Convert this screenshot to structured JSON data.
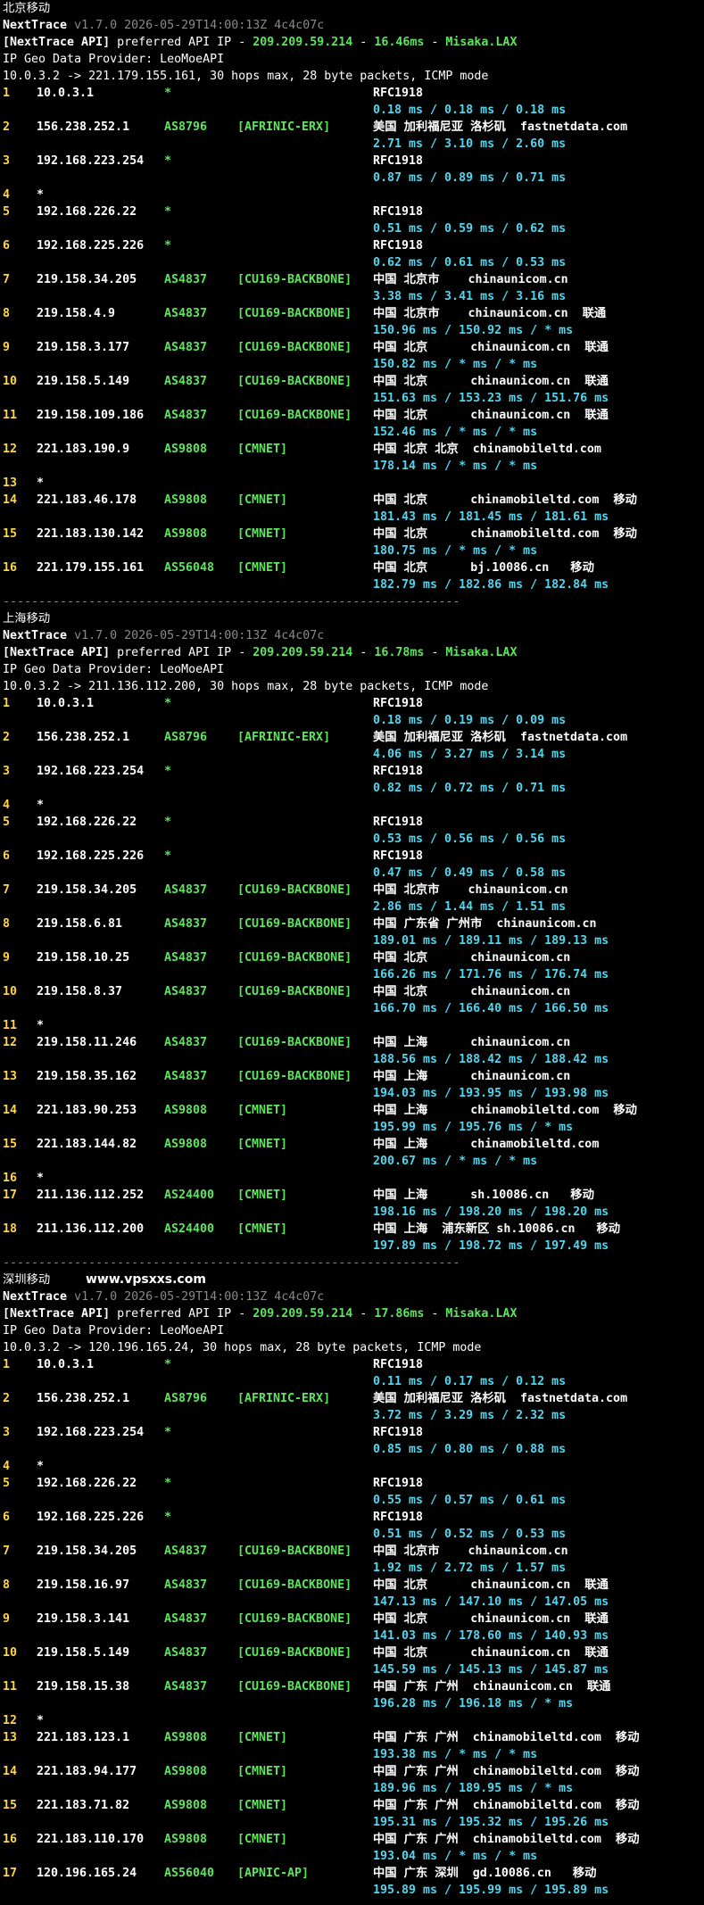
{
  "colors": {
    "background": "#000000",
    "text": "#ffffff",
    "hop_number": "#ffd54a",
    "asn": "#5ce65c",
    "rtt": "#4fd7f0",
    "muted": "#8a8a8a"
  },
  "watermark": "www.vpsxxs.com",
  "separator": "----------------------------------------------------------------",
  "sections": [
    {
      "title": "北京移动",
      "brand": "NextTrace",
      "version": "v1.7.0 2026-05-29T14:00:13Z 4c4c07c",
      "api_tag": "[NextTrace API]",
      "api_mid": " preferred API IP - ",
      "api_ip": "209.209.59.214",
      "api_dash": " - ",
      "api_ms": "16.46ms",
      "api_dash2": " - ",
      "api_node": "Misaka.LAX",
      "geo_provider": "IP Geo Data Provider: LeoMoeAPI",
      "trace_info": "10.0.3.2 -> 221.179.155.161, 30 hops max, 28 byte packets, ICMP mode",
      "hops": [
        {
          "num": "1",
          "ip": "10.0.3.1",
          "asn": "*",
          "tag": "",
          "geo": "RFC1918",
          "host": "",
          "rtt": "0.18 ms / 0.18 ms / 0.18 ms"
        },
        {
          "num": "2",
          "ip": "156.238.252.1",
          "asn": "AS8796",
          "tag": "[AFRINIC-ERX]",
          "geo": "美国 加利福尼亚 洛杉矶  fastnetdata.com",
          "host": "",
          "rtt": "2.71 ms / 3.10 ms / 2.60 ms"
        },
        {
          "num": "3",
          "ip": "192.168.223.254",
          "asn": "*",
          "tag": "",
          "geo": "RFC1918",
          "host": "",
          "rtt": "0.87 ms / 0.89 ms / 0.71 ms"
        },
        {
          "num": "4",
          "ip": "*",
          "asn": "",
          "tag": "",
          "geo": "",
          "host": "",
          "rtt": ""
        },
        {
          "num": "5",
          "ip": "192.168.226.22",
          "asn": "*",
          "tag": "",
          "geo": "RFC1918",
          "host": "",
          "rtt": "0.51 ms / 0.59 ms / 0.62 ms"
        },
        {
          "num": "6",
          "ip": "192.168.225.226",
          "asn": "*",
          "tag": "",
          "geo": "RFC1918",
          "host": "",
          "rtt": "0.62 ms / 0.61 ms / 0.53 ms"
        },
        {
          "num": "7",
          "ip": "219.158.34.205",
          "asn": "AS4837",
          "tag": "[CU169-BACKBONE]",
          "geo": "中国 北京市    chinaunicom.cn",
          "host": "",
          "rtt": "3.38 ms / 3.41 ms / 3.16 ms"
        },
        {
          "num": "8",
          "ip": "219.158.4.9",
          "asn": "AS4837",
          "tag": "[CU169-BACKBONE]",
          "geo": "中国 北京市    chinaunicom.cn  联通",
          "host": "",
          "rtt": "150.96 ms / 150.92 ms / * ms"
        },
        {
          "num": "9",
          "ip": "219.158.3.177",
          "asn": "AS4837",
          "tag": "[CU169-BACKBONE]",
          "geo": "中国 北京      chinaunicom.cn  联通",
          "host": "",
          "rtt": "150.82 ms / * ms / * ms"
        },
        {
          "num": "10",
          "ip": "219.158.5.149",
          "asn": "AS4837",
          "tag": "[CU169-BACKBONE]",
          "geo": "中国 北京      chinaunicom.cn  联通",
          "host": "",
          "rtt": "151.63 ms / 153.23 ms / 151.76 ms"
        },
        {
          "num": "11",
          "ip": "219.158.109.186",
          "asn": "AS4837",
          "tag": "[CU169-BACKBONE]",
          "geo": "中国 北京      chinaunicom.cn  联通",
          "host": "",
          "rtt": "152.46 ms / * ms / * ms"
        },
        {
          "num": "12",
          "ip": "221.183.190.9",
          "asn": "AS9808",
          "tag": "[CMNET]",
          "geo": "中国 北京 北京  chinamobileltd.com",
          "host": "",
          "rtt": "178.14 ms / * ms / * ms"
        },
        {
          "num": "13",
          "ip": "*",
          "asn": "",
          "tag": "",
          "geo": "",
          "host": "",
          "rtt": ""
        },
        {
          "num": "14",
          "ip": "221.183.46.178",
          "asn": "AS9808",
          "tag": "[CMNET]",
          "geo": "中国 北京      chinamobileltd.com  移动",
          "host": "",
          "rtt": "181.43 ms / 181.45 ms / 181.61 ms"
        },
        {
          "num": "15",
          "ip": "221.183.130.142",
          "asn": "AS9808",
          "tag": "[CMNET]",
          "geo": "中国 北京      chinamobileltd.com  移动",
          "host": "",
          "rtt": "180.75 ms / * ms / * ms"
        },
        {
          "num": "16",
          "ip": "221.179.155.161",
          "asn": "AS56048",
          "tag": "[CMNET]",
          "geo": "中国 北京      bj.10086.cn   移动",
          "host": "",
          "rtt": "182.79 ms / 182.86 ms / 182.84 ms"
        }
      ]
    },
    {
      "title": "上海移动",
      "brand": "NextTrace",
      "version": "v1.7.0 2026-05-29T14:00:13Z 4c4c07c",
      "api_tag": "[NextTrace API]",
      "api_mid": " preferred API IP - ",
      "api_ip": "209.209.59.214",
      "api_dash": " - ",
      "api_ms": "16.78ms",
      "api_dash2": " - ",
      "api_node": "Misaka.LAX",
      "geo_provider": "IP Geo Data Provider: LeoMoeAPI",
      "trace_info": "10.0.3.2 -> 211.136.112.200, 30 hops max, 28 byte packets, ICMP mode",
      "hops": [
        {
          "num": "1",
          "ip": "10.0.3.1",
          "asn": "*",
          "tag": "",
          "geo": "RFC1918",
          "host": "",
          "rtt": "0.18 ms / 0.19 ms / 0.09 ms"
        },
        {
          "num": "2",
          "ip": "156.238.252.1",
          "asn": "AS8796",
          "tag": "[AFRINIC-ERX]",
          "geo": "美国 加利福尼亚 洛杉矶  fastnetdata.com",
          "host": "",
          "rtt": "4.06 ms / 3.27 ms / 3.14 ms"
        },
        {
          "num": "3",
          "ip": "192.168.223.254",
          "asn": "*",
          "tag": "",
          "geo": "RFC1918",
          "host": "",
          "rtt": "0.82 ms / 0.72 ms / 0.71 ms"
        },
        {
          "num": "4",
          "ip": "*",
          "asn": "",
          "tag": "",
          "geo": "",
          "host": "",
          "rtt": ""
        },
        {
          "num": "5",
          "ip": "192.168.226.22",
          "asn": "*",
          "tag": "",
          "geo": "RFC1918",
          "host": "",
          "rtt": "0.53 ms / 0.56 ms / 0.56 ms"
        },
        {
          "num": "6",
          "ip": "192.168.225.226",
          "asn": "*",
          "tag": "",
          "geo": "RFC1918",
          "host": "",
          "rtt": "0.47 ms / 0.49 ms / 0.58 ms"
        },
        {
          "num": "7",
          "ip": "219.158.34.205",
          "asn": "AS4837",
          "tag": "[CU169-BACKBONE]",
          "geo": "中国 北京市    chinaunicom.cn",
          "host": "",
          "rtt": "2.86 ms / 1.44 ms / 1.51 ms"
        },
        {
          "num": "8",
          "ip": "219.158.6.81",
          "asn": "AS4837",
          "tag": "[CU169-BACKBONE]",
          "geo": "中国 广东省 广州市  chinaunicom.cn",
          "host": "",
          "rtt": "189.01 ms / 189.11 ms / 189.13 ms"
        },
        {
          "num": "9",
          "ip": "219.158.10.25",
          "asn": "AS4837",
          "tag": "[CU169-BACKBONE]",
          "geo": "中国 北京      chinaunicom.cn",
          "host": "",
          "rtt": "166.26 ms / 171.76 ms / 176.74 ms"
        },
        {
          "num": "10",
          "ip": "219.158.8.37",
          "asn": "AS4837",
          "tag": "[CU169-BACKBONE]",
          "geo": "中国 北京      chinaunicom.cn",
          "host": "",
          "rtt": "166.70 ms / 166.40 ms / 166.50 ms"
        },
        {
          "num": "11",
          "ip": "*",
          "asn": "",
          "tag": "",
          "geo": "",
          "host": "",
          "rtt": ""
        },
        {
          "num": "12",
          "ip": "219.158.11.246",
          "asn": "AS4837",
          "tag": "[CU169-BACKBONE]",
          "geo": "中国 上海      chinaunicom.cn",
          "host": "",
          "rtt": "188.56 ms / 188.42 ms / 188.42 ms"
        },
        {
          "num": "13",
          "ip": "219.158.35.162",
          "asn": "AS4837",
          "tag": "[CU169-BACKBONE]",
          "geo": "中国 上海      chinaunicom.cn",
          "host": "",
          "rtt": "194.03 ms / 193.95 ms / 193.98 ms"
        },
        {
          "num": "14",
          "ip": "221.183.90.253",
          "asn": "AS9808",
          "tag": "[CMNET]",
          "geo": "中国 上海      chinamobileltd.com  移动",
          "host": "",
          "rtt": "195.99 ms / 195.76 ms / * ms"
        },
        {
          "num": "15",
          "ip": "221.183.144.82",
          "asn": "AS9808",
          "tag": "[CMNET]",
          "geo": "中国 上海      chinamobileltd.com",
          "host": "",
          "rtt": "200.67 ms / * ms / * ms"
        },
        {
          "num": "16",
          "ip": "*",
          "asn": "",
          "tag": "",
          "geo": "",
          "host": "",
          "rtt": ""
        },
        {
          "num": "17",
          "ip": "211.136.112.252",
          "asn": "AS24400",
          "tag": "[CMNET]",
          "geo": "中国 上海      sh.10086.cn   移动",
          "host": "",
          "rtt": "198.16 ms / 198.20 ms / 198.20 ms"
        },
        {
          "num": "18",
          "ip": "211.136.112.200",
          "asn": "AS24400",
          "tag": "[CMNET]",
          "geo": "中国 上海  浦东新区 sh.10086.cn   移动",
          "host": "",
          "rtt": "197.89 ms / 198.72 ms / 197.49 ms"
        }
      ]
    },
    {
      "title": "深圳移动",
      "brand": "NextTrace",
      "version": "v1.7.0 2026-05-29T14:00:13Z 4c4c07c",
      "api_tag": "[NextTrace API]",
      "api_mid": " preferred API IP - ",
      "api_ip": "209.209.59.214",
      "api_dash": " - ",
      "api_ms": "17.86ms",
      "api_dash2": " - ",
      "api_node": "Misaka.LAX",
      "geo_provider": "IP Geo Data Provider: LeoMoeAPI",
      "trace_info": "10.0.3.2 -> 120.196.165.24, 30 hops max, 28 byte packets, ICMP mode",
      "hops": [
        {
          "num": "1",
          "ip": "10.0.3.1",
          "asn": "*",
          "tag": "",
          "geo": "RFC1918",
          "host": "",
          "rtt": "0.11 ms / 0.17 ms / 0.12 ms"
        },
        {
          "num": "2",
          "ip": "156.238.252.1",
          "asn": "AS8796",
          "tag": "[AFRINIC-ERX]",
          "geo": "美国 加利福尼亚 洛杉矶  fastnetdata.com",
          "host": "",
          "rtt": "3.72 ms / 3.29 ms / 2.32 ms"
        },
        {
          "num": "3",
          "ip": "192.168.223.254",
          "asn": "*",
          "tag": "",
          "geo": "RFC1918",
          "host": "",
          "rtt": "0.85 ms / 0.80 ms / 0.88 ms"
        },
        {
          "num": "4",
          "ip": "*",
          "asn": "",
          "tag": "",
          "geo": "",
          "host": "",
          "rtt": ""
        },
        {
          "num": "5",
          "ip": "192.168.226.22",
          "asn": "*",
          "tag": "",
          "geo": "RFC1918",
          "host": "",
          "rtt": "0.55 ms / 0.57 ms / 0.61 ms"
        },
        {
          "num": "6",
          "ip": "192.168.225.226",
          "asn": "*",
          "tag": "",
          "geo": "RFC1918",
          "host": "",
          "rtt": "0.51 ms / 0.52 ms / 0.53 ms"
        },
        {
          "num": "7",
          "ip": "219.158.34.205",
          "asn": "AS4837",
          "tag": "[CU169-BACKBONE]",
          "geo": "中国 北京市    chinaunicom.cn",
          "host": "",
          "rtt": "1.92 ms / 2.72 ms / 1.57 ms"
        },
        {
          "num": "8",
          "ip": "219.158.16.97",
          "asn": "AS4837",
          "tag": "[CU169-BACKBONE]",
          "geo": "中国 北京      chinaunicom.cn  联通",
          "host": "",
          "rtt": "147.13 ms / 147.10 ms / 147.05 ms"
        },
        {
          "num": "9",
          "ip": "219.158.3.141",
          "asn": "AS4837",
          "tag": "[CU169-BACKBONE]",
          "geo": "中国 北京      chinaunicom.cn  联通",
          "host": "",
          "rtt": "141.03 ms / 178.60 ms / 140.93 ms"
        },
        {
          "num": "10",
          "ip": "219.158.5.149",
          "asn": "AS4837",
          "tag": "[CU169-BACKBONE]",
          "geo": "中国 北京      chinaunicom.cn  联通",
          "host": "",
          "rtt": "145.59 ms / 145.13 ms / 145.87 ms"
        },
        {
          "num": "11",
          "ip": "219.158.15.38",
          "asn": "AS4837",
          "tag": "[CU169-BACKBONE]",
          "geo": "中国 广东 广州  chinaunicom.cn  联通",
          "host": "",
          "rtt": "196.28 ms / 196.18 ms / * ms"
        },
        {
          "num": "12",
          "ip": "*",
          "asn": "",
          "tag": "",
          "geo": "",
          "host": "",
          "rtt": ""
        },
        {
          "num": "13",
          "ip": "221.183.123.1",
          "asn": "AS9808",
          "tag": "[CMNET]",
          "geo": "中国 广东 广州  chinamobileltd.com  移动",
          "host": "",
          "rtt": "193.38 ms / * ms / * ms"
        },
        {
          "num": "14",
          "ip": "221.183.94.177",
          "asn": "AS9808",
          "tag": "[CMNET]",
          "geo": "中国 广东 广州  chinamobileltd.com  移动",
          "host": "",
          "rtt": "189.96 ms / 189.95 ms / * ms"
        },
        {
          "num": "15",
          "ip": "221.183.71.82",
          "asn": "AS9808",
          "tag": "[CMNET]",
          "geo": "中国 广东 广州  chinamobileltd.com  移动",
          "host": "",
          "rtt": "195.31 ms / 195.32 ms / 195.26 ms"
        },
        {
          "num": "16",
          "ip": "221.183.110.170",
          "asn": "AS9808",
          "tag": "[CMNET]",
          "geo": "中国 广东 广州  chinamobileltd.com  移动",
          "host": "",
          "rtt": "193.04 ms / * ms / * ms"
        },
        {
          "num": "17",
          "ip": "120.196.165.24",
          "asn": "AS56040",
          "tag": "[APNIC-AP]",
          "geo": "中国 广东 深圳  gd.10086.cn   移动",
          "host": "",
          "rtt": "195.89 ms / 195.99 ms / 195.89 ms"
        }
      ]
    }
  ]
}
